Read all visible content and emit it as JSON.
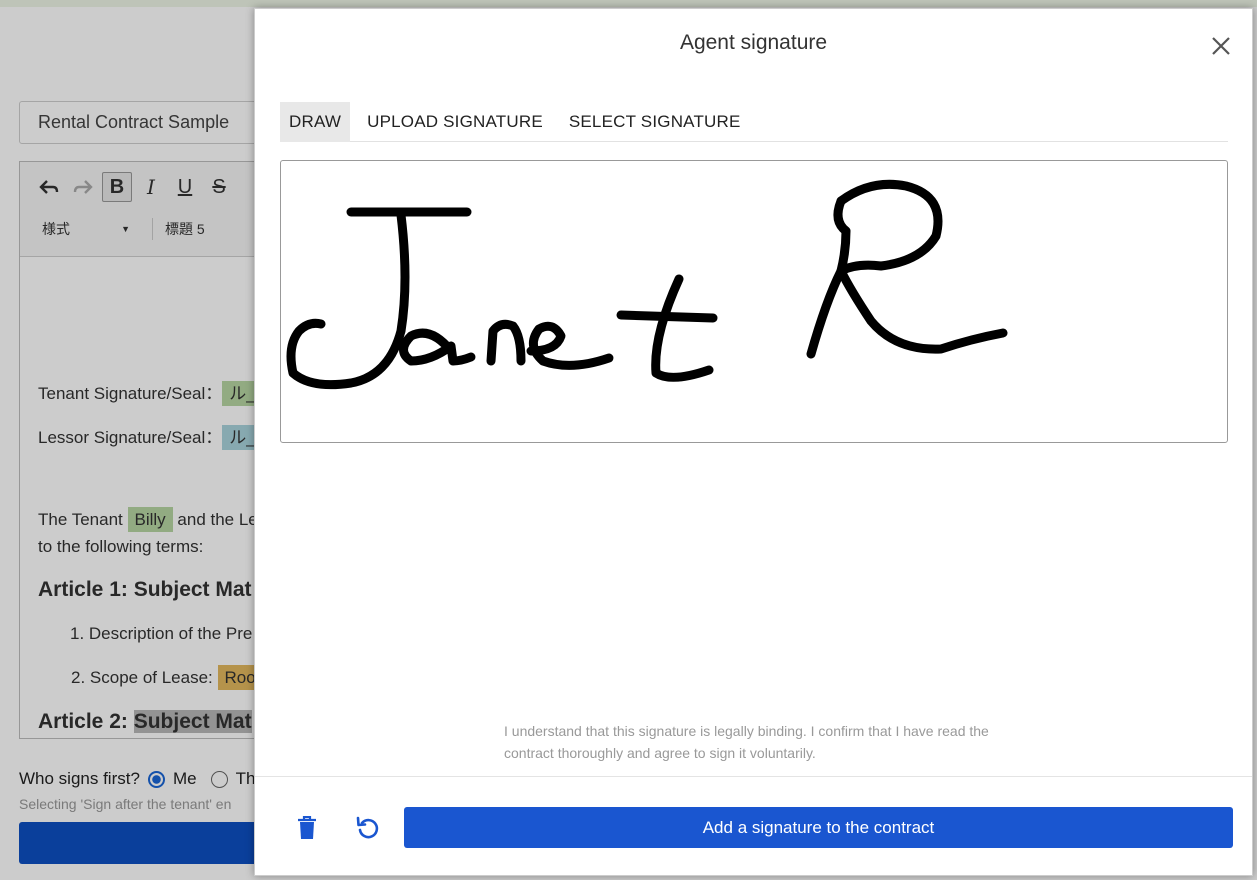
{
  "modal": {
    "title": "Agent signature",
    "tabs": [
      {
        "label": "DRAW",
        "active": true
      },
      {
        "label": "UPLOAD SIGNATURE",
        "active": false
      },
      {
        "label": "SELECT SIGNATURE",
        "active": false
      }
    ],
    "drawn_signature": "Janet R",
    "consent_text": "I understand that this signature is legally binding. I confirm that I have read the contract thoroughly and agree to sign it voluntarily.",
    "add_button_label": "Add a signature to the contract",
    "icons": {
      "close": "close-icon",
      "clear": "trash-icon",
      "undo": "undo-icon"
    },
    "colors": {
      "primary": "#1a56d0",
      "icon": "#1a56d0",
      "ink": "#000000"
    }
  },
  "background": {
    "document_title": "Rental Contract Sample",
    "toolbar": {
      "style_select": "様式",
      "heading_select": "標題 5"
    },
    "editor": {
      "tenant_signature_label": "Tenant Signature/Seal：",
      "lessor_signature_label": "Lessor Signature/Seal：",
      "signature_chip": "ル_",
      "intro_prefix": "The Tenant",
      "tenant_name": "Billy",
      "intro_suffix": "and the Le",
      "intro_line2": "to the following terms:",
      "article1": "Article 1: Subject Mat",
      "item1": "1. Description of the Pre",
      "item2_prefix": "2. Scope of Lease:",
      "item2_value": "Roor",
      "article2_prefix": "Article 2:",
      "article2_highlight": "Subject Mat"
    },
    "sign_order": {
      "question": "Who signs first?",
      "option_me": "Me",
      "option_other": "Th",
      "selected": "Me"
    },
    "sign_hint": "Selecting 'Sign after the tenant' en"
  }
}
